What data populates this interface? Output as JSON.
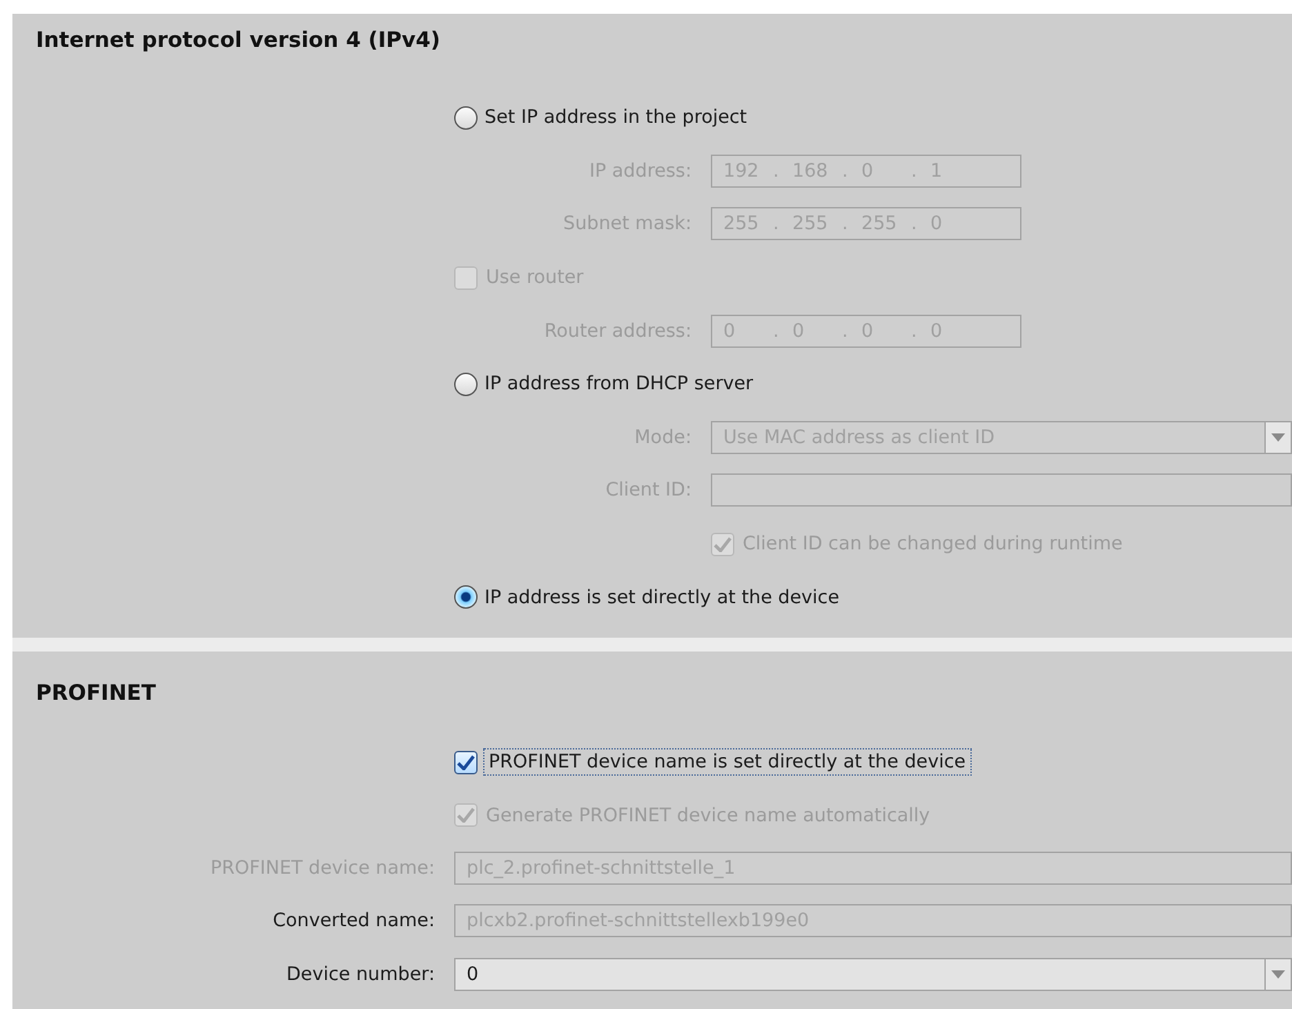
{
  "ipv4": {
    "title": "Internet protocol version 4 (IPv4)",
    "rows": [
      {
        "kind": "radio",
        "label": "Set IP address in the project",
        "selected": false
      },
      {
        "kind": "ip_field",
        "label": "IP address:",
        "octets": [
          "192",
          "168",
          "0",
          "1"
        ],
        "separator": ".",
        "disabled": true
      },
      {
        "kind": "ip_field",
        "label": "Subnet mask:",
        "octets": [
          "255",
          "255",
          "255",
          "0"
        ],
        "separator": ".",
        "disabled": true
      },
      {
        "kind": "checkbox",
        "label": "Use router",
        "checked": false,
        "disabled": true
      },
      {
        "kind": "ip_field",
        "label": "Router address:",
        "octets": [
          "0",
          "0",
          "0",
          "0"
        ],
        "separator": ".",
        "disabled": true
      },
      {
        "kind": "radio",
        "label": "IP address from DHCP server",
        "selected": false
      },
      {
        "kind": "dropdown",
        "label": "Mode:",
        "value": "Use MAC address as client ID",
        "disabled": true
      },
      {
        "kind": "text_field",
        "label": "Client ID:",
        "disabled": true
      },
      {
        "kind": "option",
        "label": "Client ID can be changed during runtime",
        "checked": true,
        "disabled": true
      },
      {
        "kind": "radio",
        "label": "IP address is set directly at the device",
        "selected": true
      }
    ]
  },
  "profinet": {
    "title": "PROFINET",
    "rows": [
      {
        "kind": "checkbox",
        "label": "PROFINET device name is set directly at the device",
        "checked": true,
        "disabled": false,
        "focused": true
      },
      {
        "kind": "checkbox",
        "label": "Generate PROFINET device name automatically",
        "checked": true,
        "disabled": true
      },
      {
        "kind": "text_field",
        "label": "PROFINET device name:",
        "value": "plc_2.profinet-schnittstelle_1",
        "disabled": true,
        "label_disabled": true
      },
      {
        "kind": "text_field",
        "label": "Converted name:",
        "value": "plcxb2.profinet-schnittstellexb199e0",
        "disabled": true,
        "label_disabled": false
      },
      {
        "kind": "dropdown",
        "label": "Device number:",
        "value": "0",
        "disabled": false
      }
    ]
  }
}
